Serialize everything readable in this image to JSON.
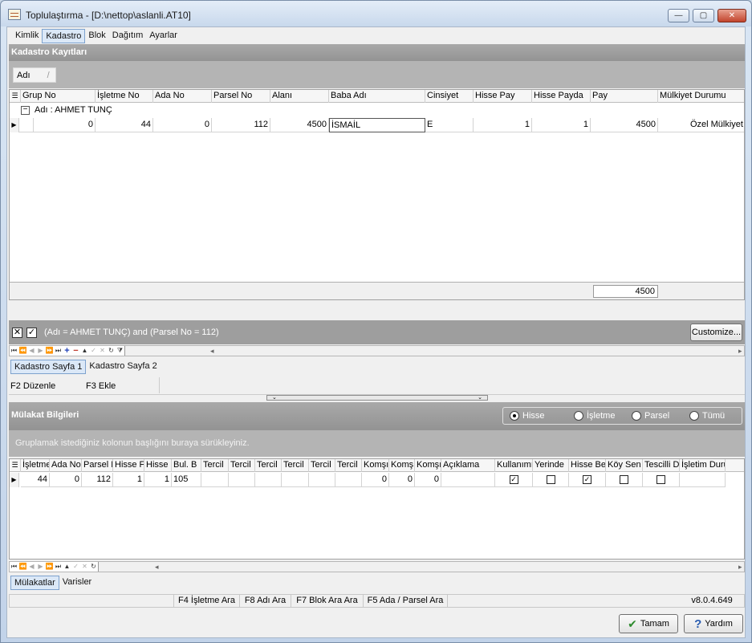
{
  "window": {
    "title": "Toplulaştırma - [D:\\nettop\\aslanli.AT10]",
    "min_glyph": "—",
    "max_glyph": "▢",
    "close_glyph": "✕"
  },
  "main_tabs": [
    "Kimlik",
    "Kadastro",
    "Blok",
    "Dağıtım",
    "Ayarlar"
  ],
  "main_tab_active": "Kadastro",
  "kadastro": {
    "panel_title": "Kadastro Kayıtları",
    "group_chip": "Adı",
    "group_chip_sort": "/",
    "columns": [
      "Grup No",
      "İşletme No",
      "Ada No",
      "Parsel No",
      "Alanı",
      "Baba Adı",
      "Cinsiyet",
      "Hisse Pay",
      "Hisse Payda",
      "Pay",
      "Mülkiyet Durumu"
    ],
    "parsel_sort_glyph": "/",
    "group_row": "Adı : AHMET TUNÇ",
    "group_toggle": "−",
    "rows": [
      {
        "grup_no": "0",
        "isletme_no": "44",
        "ada_no": "0",
        "parsel_no": "112",
        "alani": "4500",
        "baba_adi": "İSMAİL",
        "cinsiyet": "E",
        "hisse_pay": "1",
        "hisse_payda": "1",
        "pay": "4500",
        "mulkiyet": "Özel Mülkiyet"
      }
    ],
    "footer_sum": "4500",
    "filter_text": "(Adı = AHMET TUNÇ) and (Parsel No = 112)",
    "filter_close": "✕",
    "filter_check": "✓",
    "customize_label": "Customize...",
    "sub_tabs": [
      "Kadastro Sayfa 1",
      "Kadastro Sayfa 2"
    ],
    "sub_tab_active": "Kadastro Sayfa 1",
    "hotkeys": [
      "F2 Düzenle",
      "F3 Ekle"
    ]
  },
  "nav_buttons": [
    "⏮",
    "⏪",
    "◀",
    "▶",
    "⏩",
    "⏭",
    "+",
    "−",
    "▲",
    "✓",
    "✕",
    "↻",
    "⧩"
  ],
  "mulakat": {
    "panel_title": "Mülakat Bilgileri",
    "radios": [
      {
        "label": "Hisse",
        "checked": true
      },
      {
        "label": "İşletme",
        "checked": false
      },
      {
        "label": "Parsel",
        "checked": false
      },
      {
        "label": "Tümü",
        "checked": false
      }
    ],
    "group_hint": "Gruplamak istediğiniz kolonun başlığını buraya sürükleyiniz.",
    "columns": [
      "İşletme",
      "Ada No",
      "Parsel N",
      "Hisse F",
      "Hisse F",
      "Bul. B",
      "Tercil",
      "Tercil",
      "Tercil",
      "Tercil",
      "Tercil",
      "Tercil",
      "Komşı",
      "Komş",
      "Komşı",
      "Açıklama",
      "Kullanımı",
      "Yerinde",
      "Hisse Be",
      "Köy Sen",
      "Tescilli D",
      "İşletim Durum"
    ],
    "row": {
      "isletme": "44",
      "ada_no": "0",
      "parsel_no": "112",
      "hisse_pay": "1",
      "hisse_payda": "1",
      "bul_b": "105",
      "komsu1": "0",
      "komsu2": "0",
      "komsu3": "0",
      "kullanimi": true,
      "yerinde": false,
      "hisse_be": true,
      "koy_sen": false,
      "tescilli": false
    },
    "sub_tabs": [
      "Mülakatlar",
      "Varisler"
    ],
    "sub_tab_active": "Mülakatlar"
  },
  "status": {
    "items": [
      "F4 İşletme Ara",
      "F8 Adı Ara",
      "F7 Blok Ara Ara",
      "F5 Ada / Parsel Ara"
    ],
    "version": "v8.0.4.649"
  },
  "buttons": {
    "ok": "Tamam",
    "ok_icon": "✔",
    "help": "Yardım",
    "help_icon": "?"
  },
  "colors": {
    "panel_header": "#9d9d9d",
    "ok_icon": "#2e8b2e",
    "help_icon": "#2a5db0"
  }
}
